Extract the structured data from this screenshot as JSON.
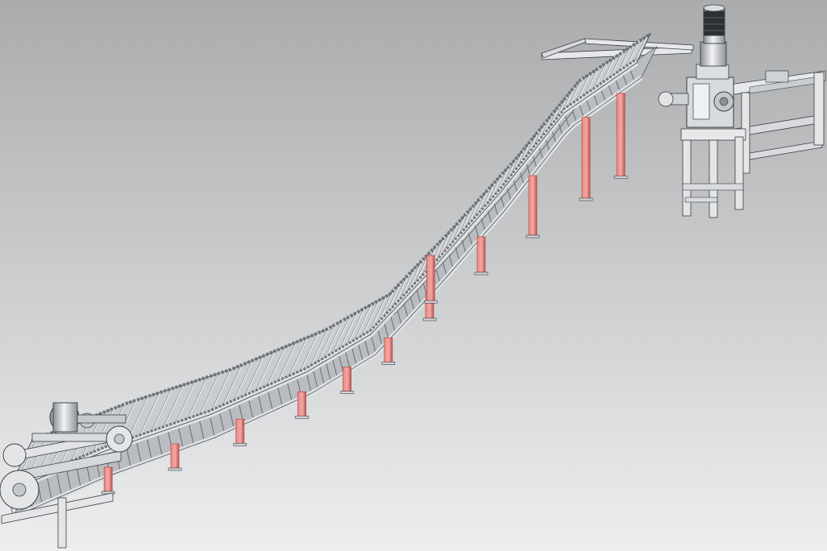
{
  "scene": {
    "subject": "inclined-chain-conveyor",
    "colors": {
      "background_top": "#a9abad",
      "background_bottom": "#eceeef",
      "frame": "#dfe1e4",
      "frame_shadow": "#8f9296",
      "slat": "#c9ccd0",
      "chain": "#6f7378",
      "outline": "#3b3e42",
      "support_leg": "#e98a86",
      "support_leg_dark": "#b75450",
      "motor_body": "#cfd2d6",
      "motor_cap": "#2c2f33"
    },
    "support_leg_count": 12,
    "slat_count": 70,
    "components": {
      "drive_motor": "motor-icon",
      "gearbox": "gearbox-icon",
      "tail_sprocket": "sprocket-icon",
      "tail_drive": "tail-drive-icon"
    }
  }
}
